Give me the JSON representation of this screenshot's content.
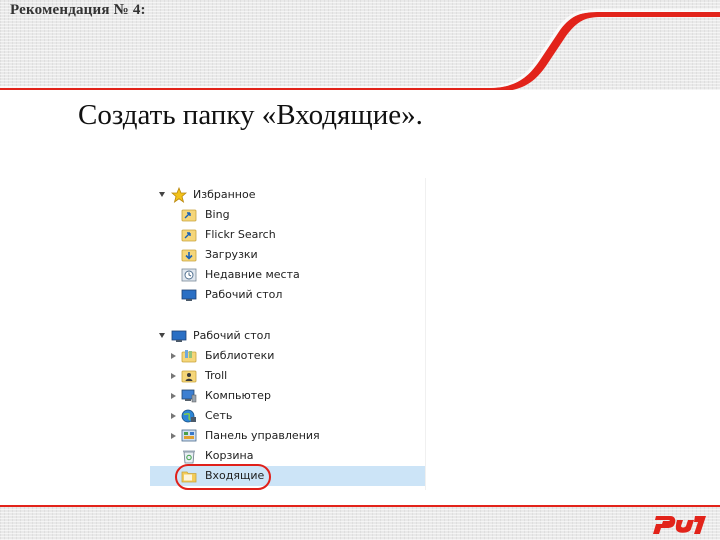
{
  "header": {
    "title": "Рекомендация № 4:"
  },
  "slide": {
    "heading": "Создать папку «Входящие»."
  },
  "explorer": {
    "favorites": {
      "label": "Избранное",
      "items": [
        {
          "label": "Bing",
          "icon": "shortcut-folder-icon"
        },
        {
          "label": "Flickr Search",
          "icon": "shortcut-folder-icon"
        },
        {
          "label": "Загрузки",
          "icon": "downloads-folder-icon"
        },
        {
          "label": "Недавние места",
          "icon": "recent-places-icon"
        },
        {
          "label": "Рабочий стол",
          "icon": "desktop-icon"
        }
      ]
    },
    "desktop": {
      "label": "Рабочий стол",
      "items": [
        {
          "label": "Библиотеки",
          "icon": "libraries-icon"
        },
        {
          "label": "Troll",
          "icon": "user-folder-icon"
        },
        {
          "label": "Компьютер",
          "icon": "computer-icon"
        },
        {
          "label": "Сеть",
          "icon": "network-icon"
        },
        {
          "label": "Панель управления",
          "icon": "control-panel-icon"
        },
        {
          "label": "Корзина",
          "icon": "recycle-bin-icon"
        },
        {
          "label": "Входящие",
          "icon": "folder-icon",
          "selected": true
        }
      ]
    }
  },
  "logo": {
    "name": "rzd-logo",
    "color": "#e2231a"
  },
  "colors": {
    "accent": "#e2231a",
    "selection": "#cce4f7"
  }
}
